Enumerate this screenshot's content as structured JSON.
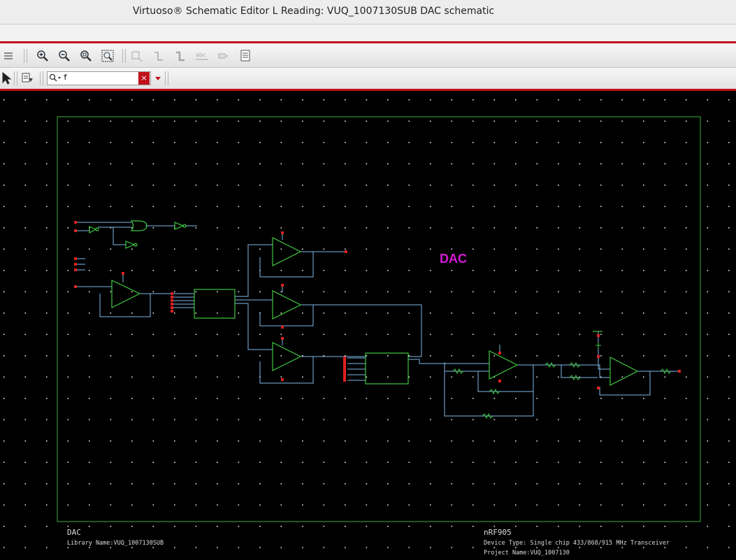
{
  "window": {
    "title": "Virtuoso® Schematic Editor L Reading: VUQ_1007130SUB DAC schematic"
  },
  "toolbar": {
    "icons": [
      "list-icon",
      "zoom-in-icon",
      "zoom-out-icon",
      "zoom-fit-icon",
      "zoom-box-icon",
      "instance-icon",
      "wire-icon",
      "wire-thick-icon",
      "label-abc-icon",
      "pin-icon",
      "property-icon"
    ]
  },
  "search": {
    "value": "f",
    "clear_symbol": "×"
  },
  "schematic": {
    "label": "DAC",
    "label_color": "#d61ad6",
    "frame_color": "#3fae3f",
    "wire_color": "#7fb7e8",
    "title_block": {
      "cell_name": "DAC",
      "library": "Library Name:VUQ_1007130SUB",
      "design": "nRF905",
      "device_type": "Device Type: Single chip 433/868/915 MHz Transceiver",
      "project": "Project Name:VUQ_1007130"
    }
  },
  "colors": {
    "accent_red": "#c1121c"
  }
}
